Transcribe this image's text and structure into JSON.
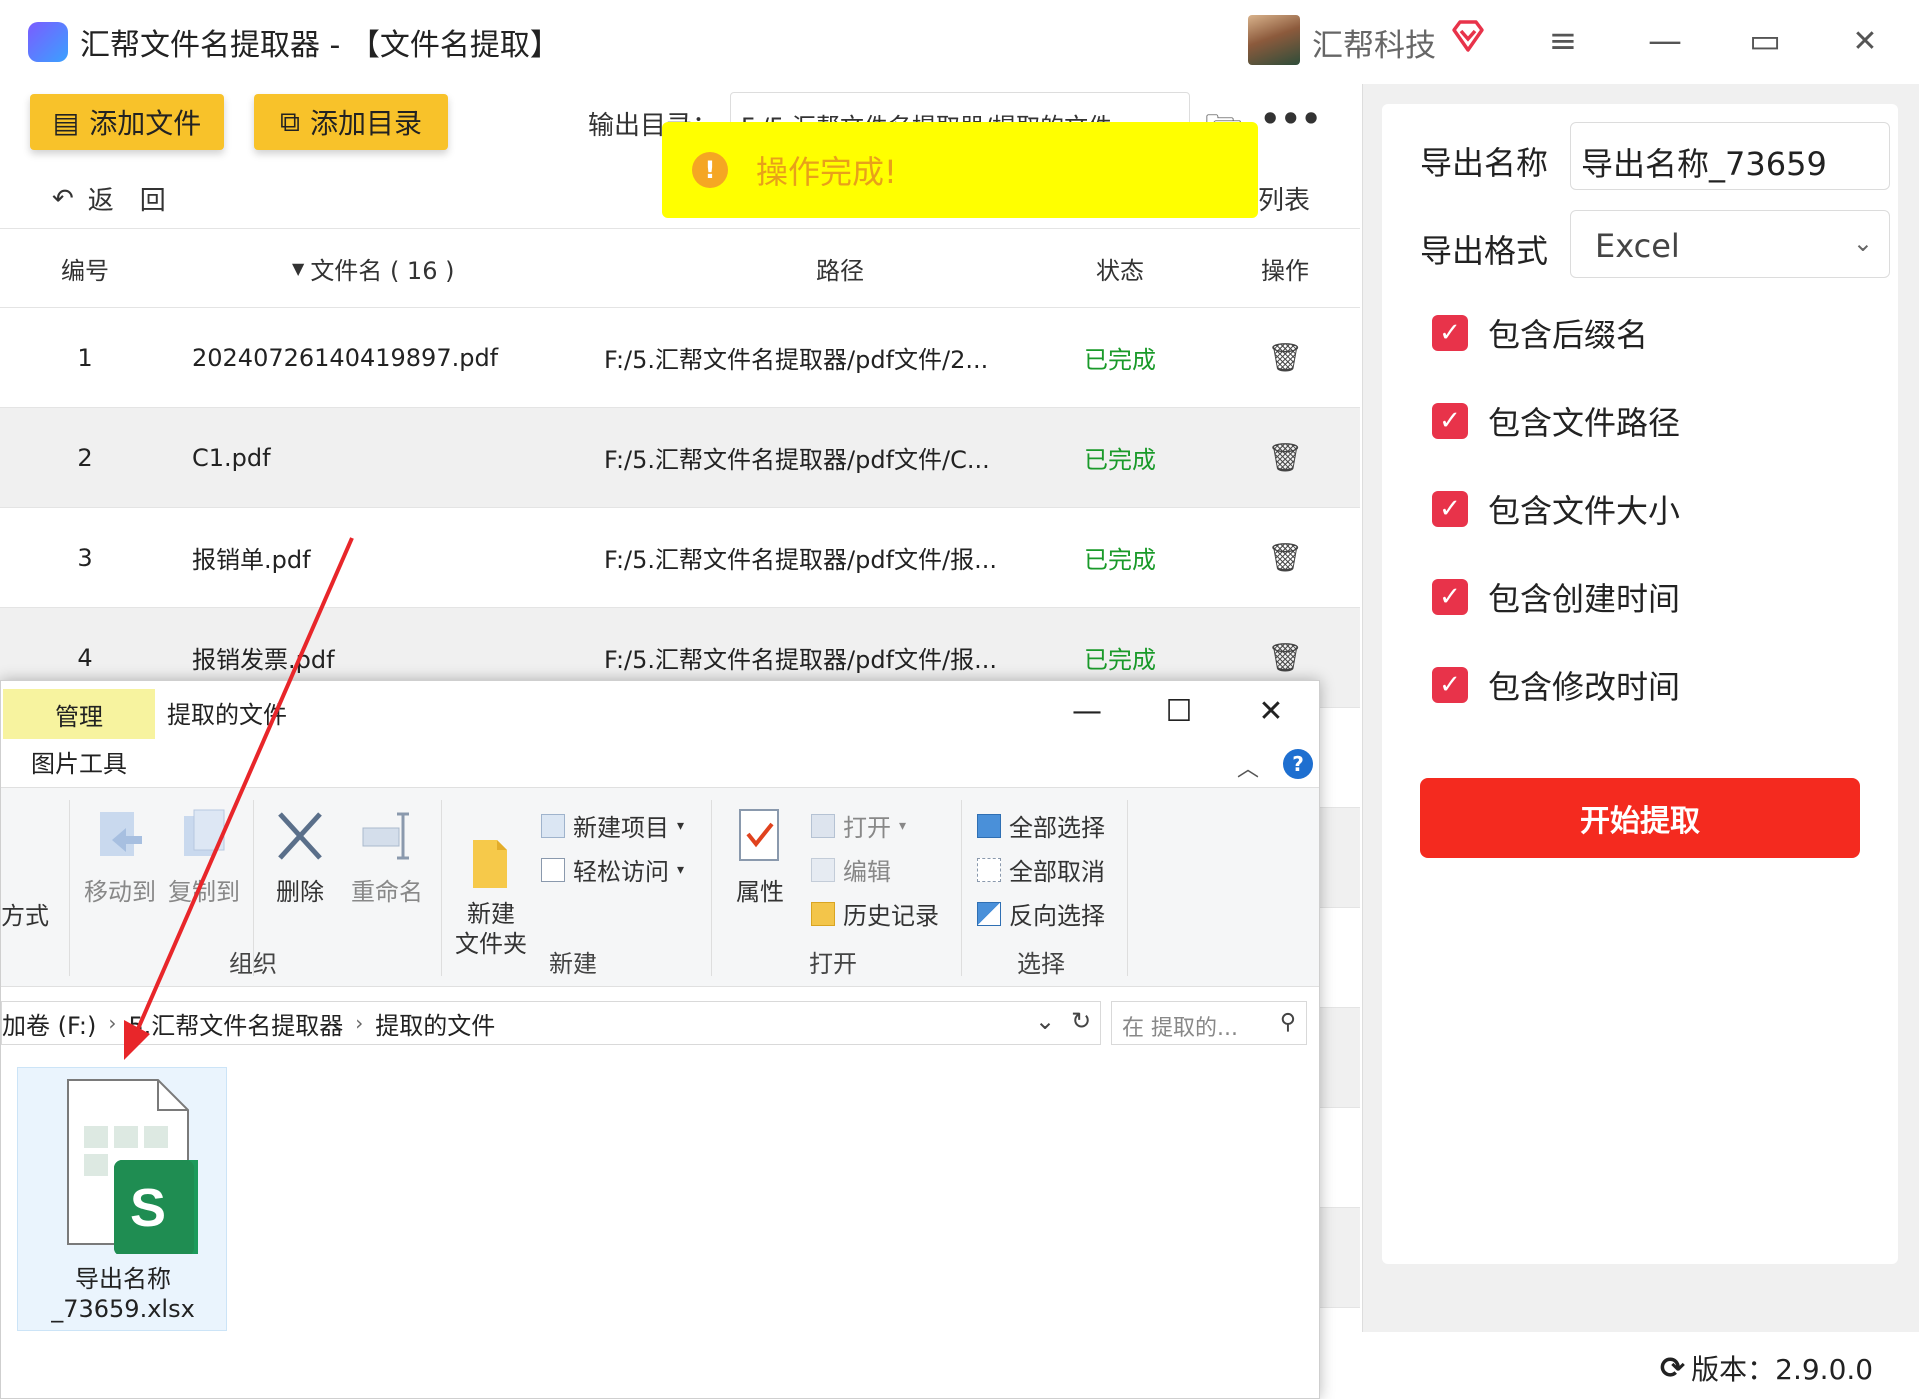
{
  "app": {
    "title": "汇帮文件名提取器 - 【文件名提取】",
    "brand": "汇帮科技",
    "window_controls": {
      "menu": "≡",
      "minimize": "—",
      "maximize": "▭",
      "close": "✕"
    }
  },
  "toolbar": {
    "add_file": "添加文件",
    "add_dir": "添加目录",
    "output_label": "输出目录：",
    "output_path": "F:/5.汇帮文件名提取器/提取的文件",
    "back": "返　回",
    "list": "列表"
  },
  "toast": {
    "text": "操作完成!",
    "icon": "!"
  },
  "table": {
    "headers": {
      "no": "编号",
      "name": "文件名 ( 16 )",
      "path": "路径",
      "status": "状态",
      "op": "操作"
    },
    "rows": [
      {
        "no": "1",
        "name": "20240726140419897.pdf",
        "path": "F:/5.汇帮文件名提取器/pdf文件/2...",
        "status": "已完成"
      },
      {
        "no": "2",
        "name": "C1.pdf",
        "path": "F:/5.汇帮文件名提取器/pdf文件/C...",
        "status": "已完成"
      },
      {
        "no": "3",
        "name": "报销单.pdf",
        "path": "F:/5.汇帮文件名提取器/pdf文件/报...",
        "status": "已完成"
      },
      {
        "no": "4",
        "name": "报销发票.pdf",
        "path": "F:/5.汇帮文件名提取器/pdf文件/报...",
        "status": "已完成"
      }
    ]
  },
  "settings": {
    "export_name_label": "导出名称",
    "export_name_value": "导出名称_73659",
    "export_format_label": "导出格式",
    "export_format_value": "Excel",
    "options": [
      "包含后缀名",
      "包含文件路径",
      "包含文件大小",
      "包含创建时间",
      "包含修改时间"
    ],
    "start": "开始提取",
    "version": "版本：2.9.0.0"
  },
  "explorer": {
    "manage_tab": "管理",
    "title": "提取的文件",
    "picture_tools": "图片工具",
    "ribbon": {
      "partial_left": "方式",
      "move_to": "移动到",
      "copy_to": "复制到",
      "delete": "删除",
      "rename": "重命名",
      "new_folder": "新建\n文件夹",
      "new_item": "新建项目",
      "easy_access": "轻松访问",
      "properties": "属性",
      "open": "打开",
      "edit": "编辑",
      "history": "历史记录",
      "select_all": "全部选择",
      "select_none": "全部取消",
      "invert": "反向选择",
      "groups": {
        "organize": "组织",
        "new": "新建",
        "open": "打开",
        "select": "选择"
      }
    },
    "address": {
      "drive": "加卷 (F:)",
      "folder1": "5.汇帮文件名提取器",
      "folder2": "提取的文件"
    },
    "search_placeholder": "在 提取的...",
    "file": {
      "line1": "导出名称",
      "line2": "_73659.xlsx",
      "icon_letter": "S"
    }
  },
  "colors": {
    "accent_yellow": "#f8c22a",
    "start_red": "#f42a1f",
    "check_red": "#e8334a",
    "status_green": "#1a9a2a",
    "toast_yellow": "#ffff00"
  }
}
